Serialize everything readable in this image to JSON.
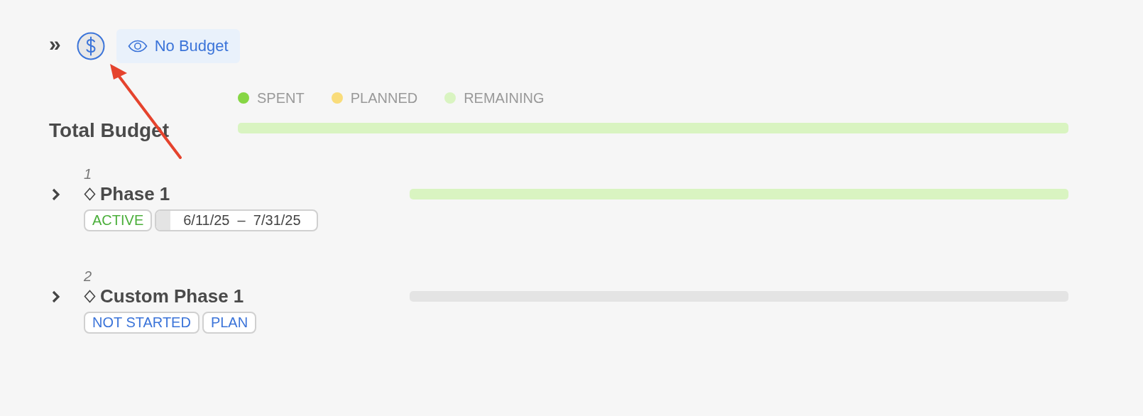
{
  "toolbar": {
    "collapse_icon": "»",
    "budget_chip": {
      "label": "No Budget"
    }
  },
  "legend": [
    {
      "label": "SPENT",
      "color": "#86d644"
    },
    {
      "label": "PLANNED",
      "color": "#f9dc7a"
    },
    {
      "label": "REMAINING",
      "color": "#d9f4c1"
    }
  ],
  "total": {
    "title": "Total Budget",
    "bar": {
      "kind": "remaining"
    }
  },
  "phases": [
    {
      "number": "1",
      "title": "Phase 1",
      "expanded": false,
      "bar": {
        "kind": "remaining"
      },
      "badges": [
        {
          "kind": "status",
          "label": "ACTIVE",
          "color": "#4caf3c"
        },
        {
          "kind": "dates",
          "label": "6/11/25  –  7/31/25"
        }
      ]
    },
    {
      "number": "2",
      "title": "Custom Phase 1",
      "expanded": false,
      "bar": {
        "kind": "empty"
      },
      "badges": [
        {
          "kind": "status",
          "label": "NOT STARTED",
          "color": "#3b74d9"
        },
        {
          "kind": "status",
          "label": "PLAN",
          "color": "#3b74d9"
        }
      ]
    }
  ],
  "annotations": [
    {
      "kind": "arrow"
    }
  ]
}
